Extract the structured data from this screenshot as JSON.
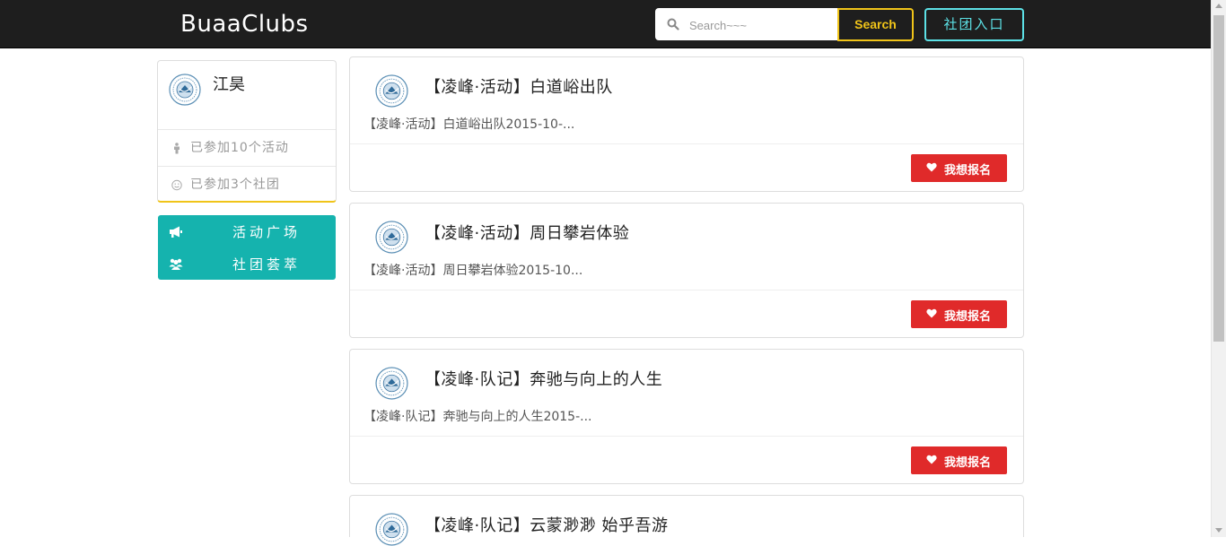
{
  "navbar": {
    "brand": "BuaaClubs",
    "search_placeholder": "Search~~~",
    "search_button": "Search",
    "club_entry_button": "社团入口"
  },
  "profile": {
    "username": "江昊",
    "activities_joined": "已参加10个活动",
    "clubs_joined": "已参加3个社团"
  },
  "menu": {
    "items": [
      {
        "label": "活动广场",
        "icon": "bullhorn-icon"
      },
      {
        "label": "社团荟萃",
        "icon": "group-icon"
      }
    ]
  },
  "feed": {
    "signup_label": "我想报名",
    "cards": [
      {
        "title": "【凌峰·活动】白道峪出队",
        "summary": "【凌峰·活动】白道峪出队2015-10-..."
      },
      {
        "title": "【凌峰·活动】周日攀岩体验",
        "summary": "【凌峰·活动】周日攀岩体验2015-10..."
      },
      {
        "title": "【凌峰·队记】奔驰与向上的人生",
        "summary": "【凌峰·队记】奔驰与向上的人生2015-..."
      },
      {
        "title": "【凌峰·队记】云蒙渺渺 始乎吾游",
        "summary": ""
      }
    ]
  },
  "colors": {
    "navbar_bg": "#1e1e1e",
    "search_accent": "#f0c419",
    "entry_accent": "#5ce1e6",
    "menu_bg": "#15b3ae",
    "signup_bg": "#e02a2a"
  }
}
